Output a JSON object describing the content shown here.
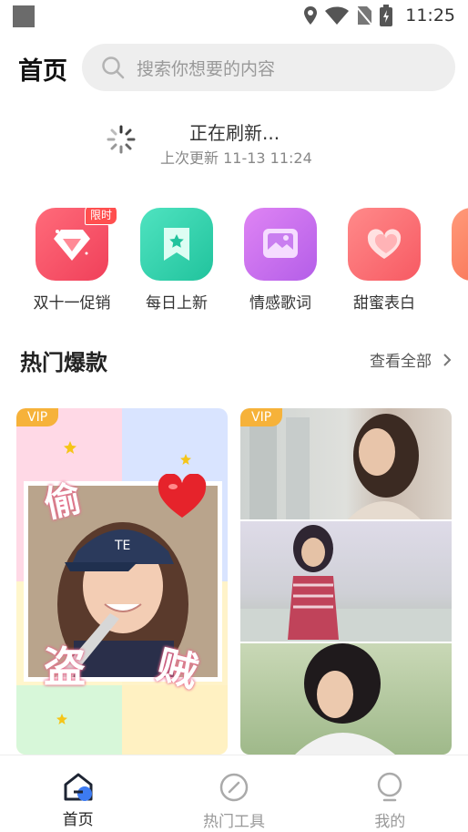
{
  "status_bar": {
    "time": "11:25"
  },
  "header": {
    "title": "首页",
    "search_placeholder": "搜索你想要的内容"
  },
  "refresh": {
    "title": "正在刷新...",
    "subtitle": "上次更新 11-13 11:24"
  },
  "categories": [
    {
      "label": "双十一促销",
      "icon": "diamond-icon",
      "badge": "限时",
      "color_from": "#ff6b7a",
      "color_to": "#f0405a"
    },
    {
      "label": "每日上新",
      "icon": "bookmark-star-icon",
      "color_from": "#4fe3c0",
      "color_to": "#21c39d"
    },
    {
      "label": "情感歌词",
      "icon": "picture-icon",
      "color_from": "#df84f4",
      "color_to": "#b45ee8"
    },
    {
      "label": "甜蜜表白",
      "icon": "hearts-icon",
      "color_from": "#ff8a8a",
      "color_to": "#f75a63"
    }
  ],
  "section": {
    "title": "热门爆款",
    "see_all": "查看全部"
  },
  "cards": [
    {
      "badge": "VIP",
      "sticker_text_1": "偷",
      "sticker_text_2": "盗",
      "sticker_text_3": "贼"
    },
    {
      "badge": "VIP"
    }
  ],
  "bottom_nav": [
    {
      "label": "首页",
      "icon": "home-icon",
      "active": true
    },
    {
      "label": "热门工具",
      "icon": "compass-icon",
      "active": false
    },
    {
      "label": "我的",
      "icon": "bulb-icon",
      "active": false
    }
  ]
}
